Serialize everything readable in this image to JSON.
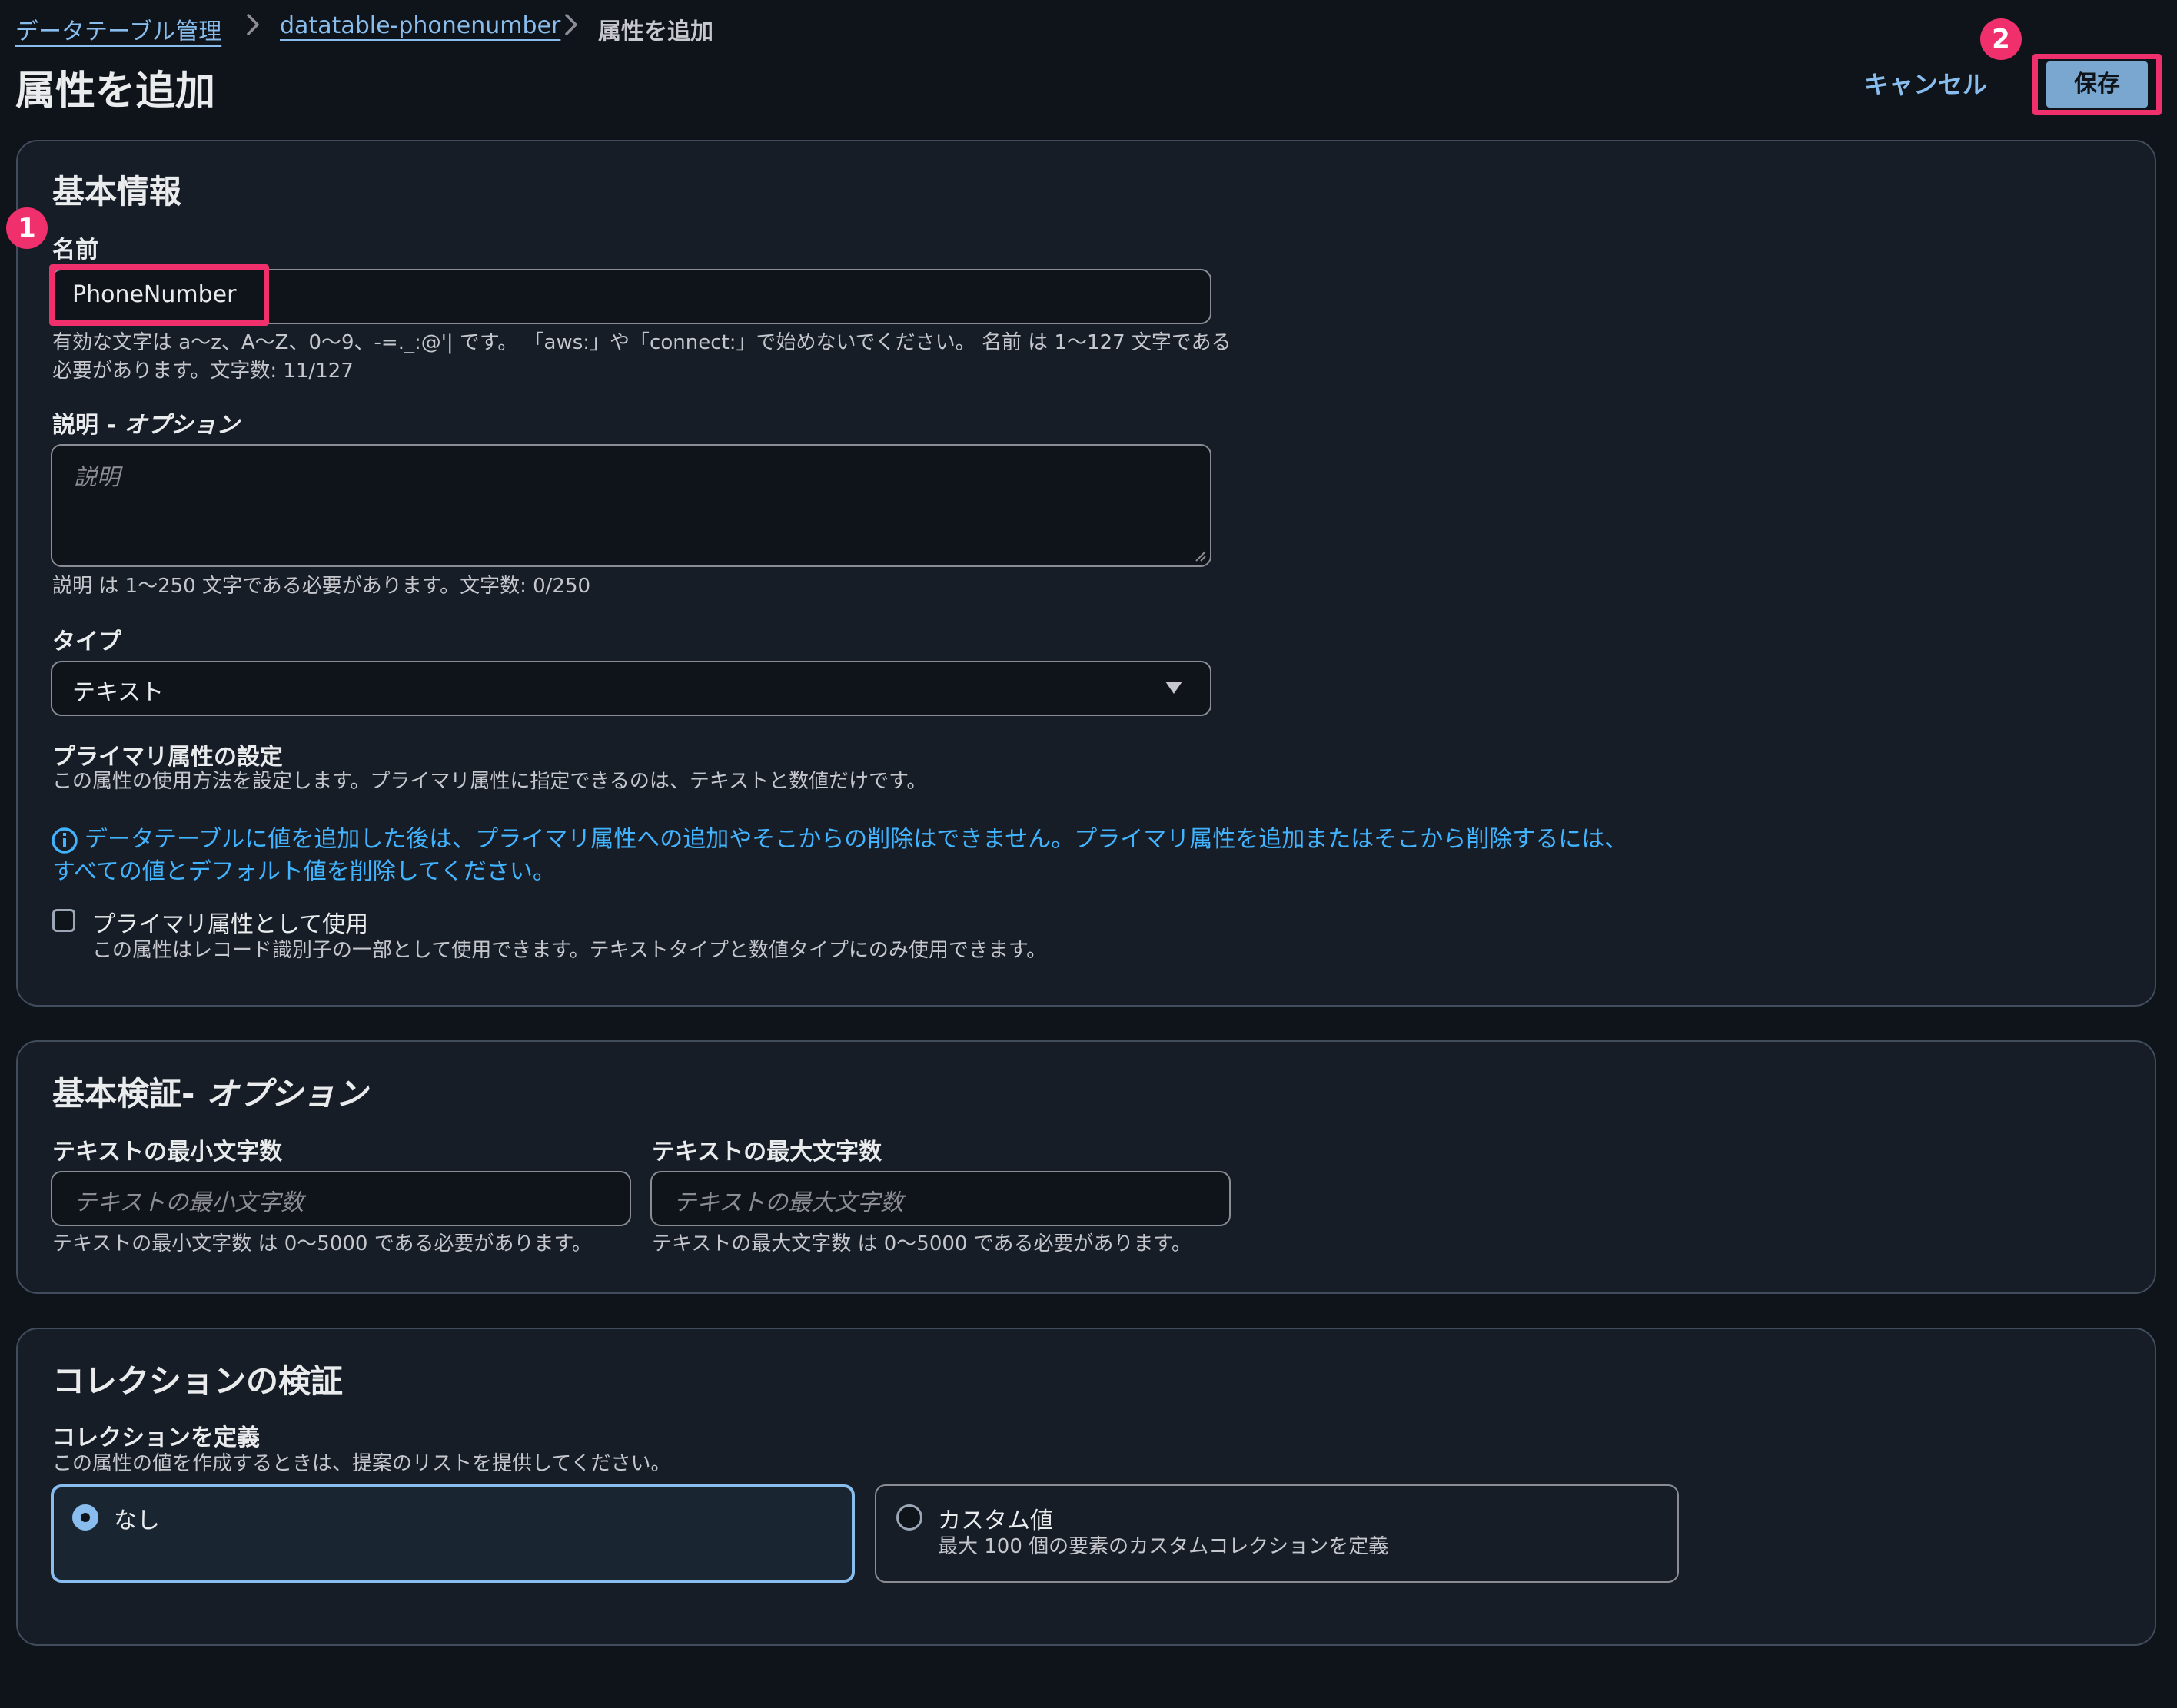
{
  "breadcrumb": {
    "items": [
      "データテーブル管理",
      "datatable-phonenumber"
    ],
    "current": "属性を追加"
  },
  "header": {
    "title": "属性を追加",
    "cancel_label": "キャンセル",
    "save_label": "保存"
  },
  "annotations": {
    "marker_1": "1",
    "marker_2": "2"
  },
  "basic_info": {
    "heading": "基本情報",
    "name_label": "名前",
    "name_value": "PhoneNumber",
    "name_hint_line1": "有効な文字は a〜z、A〜Z、0〜9、-=._:@'| です。 「aws:」や「connect:」で始めないでください。 名前 は 1〜127 文字である",
    "name_hint_line2": "必要があります。文字数: 11/127",
    "description_label": "説明 - ",
    "description_label_optional": "オプション",
    "description_placeholder": "説明",
    "description_hint": "説明 は 1〜250 文字である必要があります。文字数: 0/250",
    "type_label": "タイプ",
    "type_value": "テキスト",
    "primary_heading": "プライマリ属性の設定",
    "primary_desc": "この属性の使用方法を設定します。プライマリ属性に指定できるのは、テキストと数値だけです。",
    "info_line1": "データテーブルに値を追加した後は、プライマリ属性への追加やそこからの削除はできません。プライマリ属性を追加またはそこから削除するには、",
    "info_line2": "すべての値とデフォルト値を削除してください。",
    "checkbox_label": "プライマリ属性として使用",
    "checkbox_checked": false,
    "checkbox_desc": "この属性はレコード識別子の一部として使用できます。テキストタイプと数値タイプにのみ使用できます。"
  },
  "basic_validation": {
    "heading": "基本検証- ",
    "heading_optional": "オプション",
    "min_label": "テキストの最小文字数",
    "min_placeholder": "テキストの最小文字数",
    "min_hint": "テキストの最小文字数 は 0〜5000 である必要があります。",
    "max_label": "テキストの最大文字数",
    "max_placeholder": "テキストの最大文字数",
    "max_hint": "テキストの最大文字数 は 0〜5000 である必要があります。"
  },
  "collection_validation": {
    "heading": "コレクションの検証",
    "define_label": "コレクションを定義",
    "define_desc": "この属性の値を作成するときは、提案のリストを提供してください。",
    "option_none_label": "なし",
    "option_custom_label": "カスタム値",
    "option_custom_desc": "最大 100 個の要素のカスタムコレクションを定義",
    "selected": "なし"
  },
  "colors": {
    "background": "#0f141a",
    "panel": "#161d26",
    "border": "#414d5c",
    "link": "#89bdee",
    "primary_button": "#7aa7cf",
    "info": "#42b4ff",
    "highlight": "#f0306d"
  },
  "icons": [
    "chevron-right-icon",
    "caret-down-icon",
    "info-circle-icon",
    "radio-selected-icon",
    "radio-empty-icon"
  ]
}
